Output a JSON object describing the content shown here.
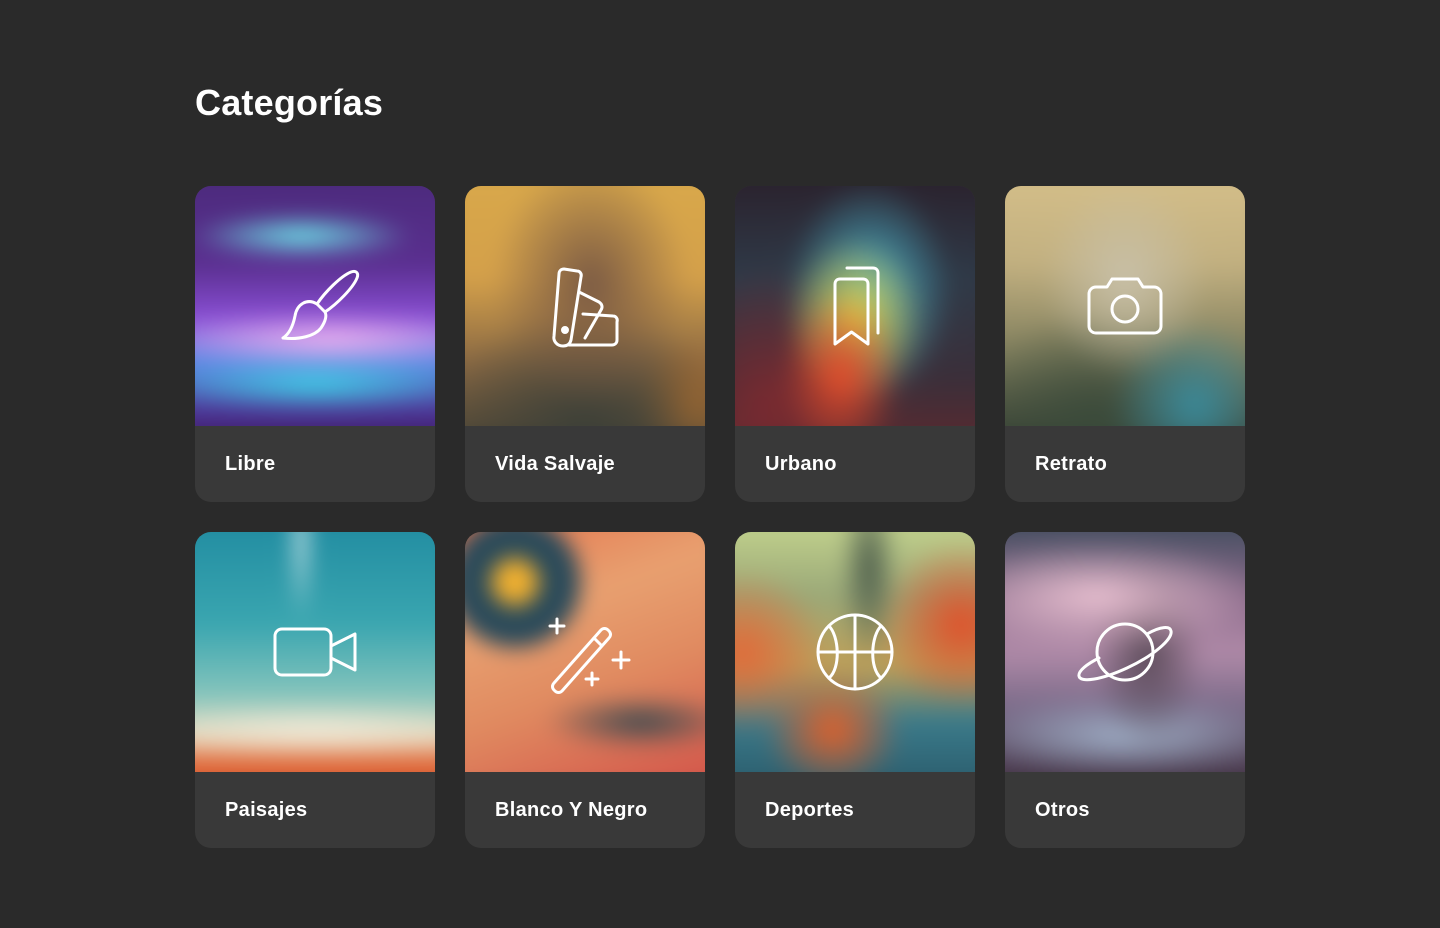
{
  "page": {
    "title": "Categorías"
  },
  "colors": {
    "background": "#2a2a2a",
    "card_label_bg": "#393939",
    "text": "#ffffff"
  },
  "categories": [
    {
      "label": "Libre",
      "icon": "paintbrush-icon"
    },
    {
      "label": "Vida Salvaje",
      "icon": "color-swatch-icon"
    },
    {
      "label": "Urbano",
      "icon": "bookmarks-icon"
    },
    {
      "label": "Retrato",
      "icon": "camera-icon"
    },
    {
      "label": "Paisajes",
      "icon": "video-camera-icon"
    },
    {
      "label": "Blanco Y Negro",
      "icon": "magic-wand-icon"
    },
    {
      "label": "Deportes",
      "icon": "basketball-icon"
    },
    {
      "label": "Otros",
      "icon": "planet-icon"
    }
  ]
}
